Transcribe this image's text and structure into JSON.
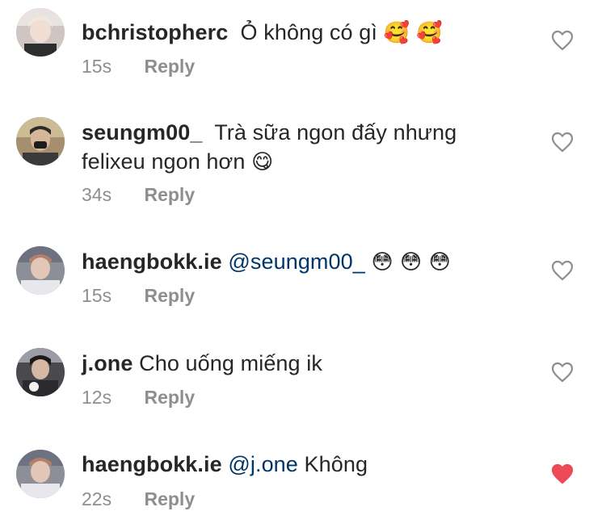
{
  "comments": [
    {
      "username": "bchristopherc",
      "pre": "",
      "mention": "",
      "text": "Ỏ không có gì",
      "emoji": "🥰 🥰",
      "time": "15s",
      "reply": "Reply",
      "liked": false
    },
    {
      "username": "seungm00_",
      "pre": "",
      "mention": "",
      "text": "Trà sữa ngon đấy nhưng felixeu ngon hơn",
      "emoji": "😋",
      "time": "34s",
      "reply": "Reply",
      "liked": false
    },
    {
      "username": "haengbokk.ie",
      "pre": "",
      "mention": "@seungm00_",
      "text": "",
      "emoji": "😳 😳 😳",
      "time": "15s",
      "reply": "Reply",
      "liked": false
    },
    {
      "username": "j.one",
      "pre": "",
      "mention": "",
      "text": "Cho uống miếng ik",
      "emoji": "",
      "time": "12s",
      "reply": "Reply",
      "liked": false
    },
    {
      "username": "haengbokk.ie",
      "pre": "",
      "mention": "@j.one",
      "text": "Không",
      "emoji": "",
      "time": "22s",
      "reply": "Reply",
      "liked": true
    }
  ],
  "colors": {
    "text": "#262626",
    "meta": "#8e8e8e",
    "mention": "#003569",
    "heart_outline": "#8e8e8e",
    "heart_liked": "#ed4956"
  },
  "icons": {
    "like": "heart-outline-icon",
    "liked": "heart-filled-icon"
  }
}
